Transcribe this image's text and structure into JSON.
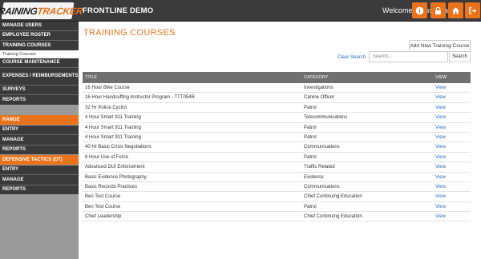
{
  "header": {
    "logo_prefix": "TRAINING",
    "logo_suffix": "TRACKER",
    "org_name": "FRONTLINE DEMO",
    "welcome": "Welcome: Russ Real",
    "icons": [
      "info-icon",
      "lock-icon",
      "home-icon",
      "logout-icon"
    ]
  },
  "sidebar": {
    "items": [
      {
        "label": "MANAGE USERS"
      },
      {
        "label": "EMPLOYEE ROSTER"
      },
      {
        "label": "TRAINING COURSES"
      },
      {
        "label": "Training Courses"
      },
      {
        "label": "COURSE MAINTENANCE"
      },
      {
        "label": "EXPENSES / REIMBURSEMENTS"
      },
      {
        "label": "SURVEYS"
      },
      {
        "label": "REPORTS"
      },
      {
        "label": "RANGE"
      },
      {
        "label": "ENTRY"
      },
      {
        "label": "MANAGE"
      },
      {
        "label": "REPORTS"
      },
      {
        "label": "DEFENSIVE TACTICS (DT)"
      },
      {
        "label": "ENTRY"
      },
      {
        "label": "MANAGE"
      },
      {
        "label": "REPORTS"
      }
    ]
  },
  "main": {
    "title": "TRAINING COURSES",
    "add_button": "Add New Training Course",
    "clear_search": "Clear Search",
    "search_placeholder": "Search...",
    "search_button": "Search",
    "columns": {
      "title": "TITLE",
      "category": "CATEGORY",
      "view": "VIEW"
    },
    "rows": [
      {
        "title": "16 Hour Bike Course",
        "category": "Investigations",
        "view": "View"
      },
      {
        "title": "16 Hour Handcuffing Instructor Program - TTT054R",
        "category": "Canine Officer",
        "view": "View"
      },
      {
        "title": "32 Hr Police Cyclist",
        "category": "Patrol",
        "view": "View"
      },
      {
        "title": "4 Hour Smart 911 Training",
        "category": "Telecommunications",
        "view": "View"
      },
      {
        "title": "4 Hour Smart 911 Training",
        "category": "Patrol",
        "view": "View"
      },
      {
        "title": "4 Hour Smart 911 Training",
        "category": "Patrol",
        "view": "View"
      },
      {
        "title": "40 Hr Basic Crisis Negotiations",
        "category": "Communications",
        "view": "View"
      },
      {
        "title": "8 Hour Use of Force",
        "category": "Patrol",
        "view": "View"
      },
      {
        "title": "Advanced DUI Enforcement",
        "category": "Traffic Related",
        "view": "View"
      },
      {
        "title": "Basic Evidence Photography",
        "category": "Evidence",
        "view": "View"
      },
      {
        "title": "Basic Records Practices",
        "category": "Communications",
        "view": "View"
      },
      {
        "title": "Ben Test Course",
        "category": "Chief Continuing Education",
        "view": "View"
      },
      {
        "title": "Ben Test Course",
        "category": "Patrol",
        "view": "View"
      },
      {
        "title": "Chief Leadership",
        "category": "Chief Continuing Education",
        "view": "View"
      }
    ]
  },
  "colors": {
    "accent": "#e8731a",
    "topbar": "#3b3b3b",
    "link": "#2a6db5"
  }
}
